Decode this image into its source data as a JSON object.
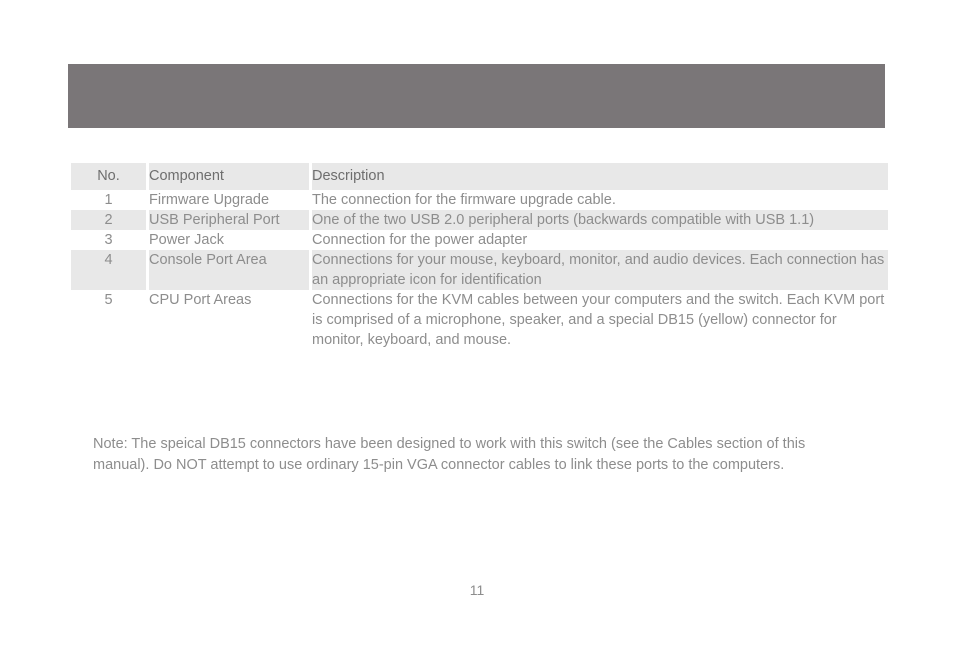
{
  "banner": {
    "color": "#7a7678"
  },
  "table": {
    "headers": {
      "no": "No.",
      "component": "Component",
      "description": "Description"
    },
    "rows": [
      {
        "no": "1",
        "component": "Firmware Upgrade",
        "description": "The connection for the firmware upgrade cable."
      },
      {
        "no": "2",
        "component": "USB Peripheral Port",
        "description": "One of the two USB 2.0 peripheral ports (backwards compatible with USB 1.1)"
      },
      {
        "no": "3",
        "component": "Power Jack",
        "description": "Connection for the power adapter"
      },
      {
        "no": "4",
        "component": "Console Port Area",
        "description": "Connections for your mouse, keyboard, monitor, and audio devices. Each connection has an appropriate icon for identification"
      },
      {
        "no": "5",
        "component": "CPU Port Areas",
        "description": "Connections for the KVM cables between your computers and the switch.  Each KVM port is comprised of a microphone, speaker, and a special DB15 (yellow) connector for monitor, keyboard, and mouse."
      }
    ]
  },
  "note": {
    "text": "Note: The speical DB15 connectors have been designed to work with this switch (see the Cables section of this manual). Do NOT attempt to use ordinary 15-pin VGA connector cables to link these ports to the computers."
  },
  "footer": {
    "page_number": "11"
  },
  "colors": {
    "banner": "#7a7678",
    "row_shade": "#e8e8e8",
    "header_text": "#6e6e6e",
    "body_text": "#8d8d8d"
  }
}
